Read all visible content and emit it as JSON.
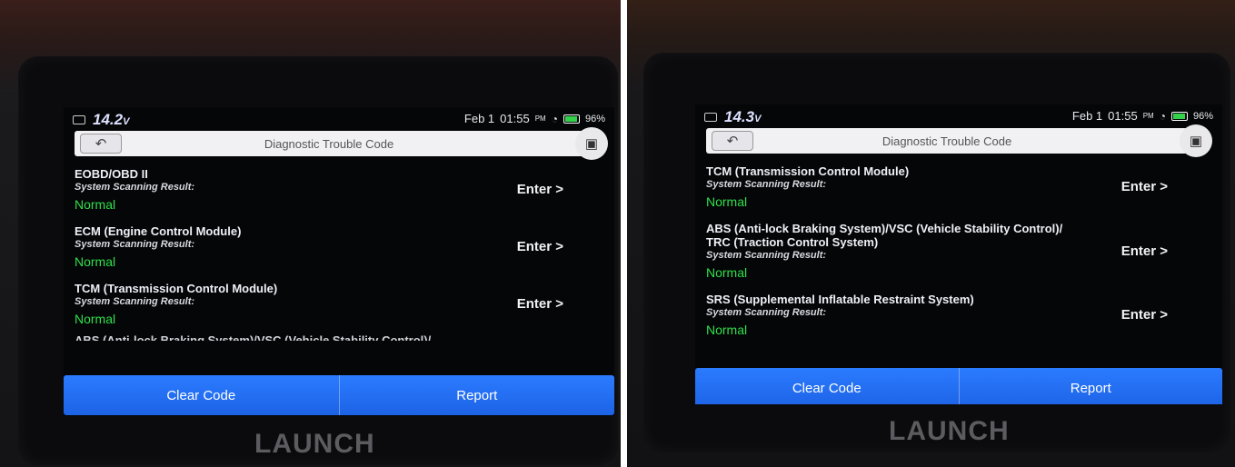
{
  "left_screen": {
    "brand": "LAUNCH",
    "status": {
      "voltage": "14.2",
      "voltage_unit": "V",
      "date": "Feb 1",
      "time": "01:55",
      "ampm": "PM",
      "battery": "96%"
    },
    "title": "Diagnostic Trouble Code",
    "rows": [
      {
        "system": "EOBD/OBD II",
        "result_label": "System Scanning Result:",
        "result": "Normal",
        "action": "Enter >"
      },
      {
        "system": "ECM (Engine Control Module)",
        "result_label": "System Scanning Result:",
        "result": "Normal",
        "action": "Enter >"
      },
      {
        "system": "TCM (Transmission Control Module)",
        "result_label": "System Scanning Result:",
        "result": "Normal",
        "action": "Enter >"
      }
    ],
    "cutoff_text": "ABS (Anti-lock Braking System)/VSC (Vehicle Stability Control)/",
    "buttons": {
      "clear": "Clear Code",
      "report": "Report"
    }
  },
  "right_screen": {
    "brand": "LAUNCH",
    "status": {
      "voltage": "14.3",
      "voltage_unit": "V",
      "date": "Feb 1",
      "time": "01:55",
      "ampm": "PM",
      "battery": "96%"
    },
    "title": "Diagnostic Trouble Code",
    "rows": [
      {
        "system": "TCM (Transmission Control Module)",
        "result_label": "System Scanning Result:",
        "result": "Normal",
        "action": "Enter >"
      },
      {
        "system": "ABS (Anti-lock Braking System)/VSC (Vehicle Stability Control)/",
        "system_line2": "TRC (Traction Control System)",
        "result_label": "System Scanning Result:",
        "result": "Normal",
        "action": "Enter >"
      },
      {
        "system": "SRS (Supplemental Inflatable Restraint System)",
        "result_label": "System Scanning Result:",
        "result": "Normal",
        "action": "Enter >"
      }
    ],
    "buttons": {
      "clear": "Clear Code",
      "report": "Report"
    }
  },
  "icons": {
    "back": "back-arrow-icon",
    "camera": "camera-icon",
    "wifi": "wifi-icon",
    "battery": "battery-icon"
  },
  "colors": {
    "normal_green": "#2fe04a",
    "button_blue": "#1d63e6"
  }
}
